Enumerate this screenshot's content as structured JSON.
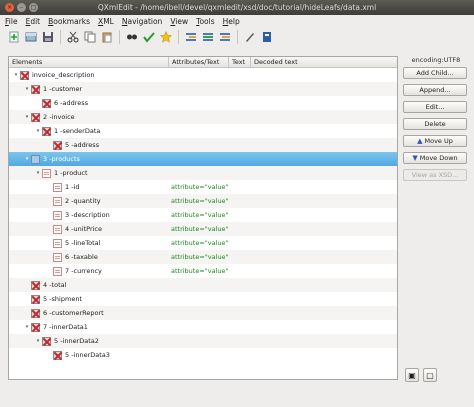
{
  "window": {
    "title": "QXmlEdit - /home/ibell/devel/qxmledit/xsd/doc/tutorial/hideLeafs/data.xml",
    "close_glyph": "×",
    "min_glyph": "–",
    "max_glyph": "□"
  },
  "menu": [
    {
      "label": "File",
      "accel": "F",
      "rest": "ile"
    },
    {
      "label": "Edit",
      "accel": "E",
      "rest": "dit"
    },
    {
      "label": "Bookmarks",
      "accel": "B",
      "rest": "ookmarks"
    },
    {
      "label": "XML",
      "accel": "X",
      "rest": "ML"
    },
    {
      "label": "Navigation",
      "accel": "N",
      "rest": "avigation"
    },
    {
      "label": "View",
      "accel": "V",
      "rest": "iew"
    },
    {
      "label": "Tools",
      "accel": "T",
      "rest": "ools"
    },
    {
      "label": "Help",
      "accel": "H",
      "rest": "elp"
    }
  ],
  "toolbar_icons": [
    "new-icon",
    "open-icon",
    "save-icon",
    "cut-icon",
    "copy-icon",
    "paste-icon",
    "find-icon",
    "validate-icon",
    "bookmark-star-icon",
    "indent-icon",
    "add-icon",
    "remove-icon",
    "pen-icon",
    "help-icon"
  ],
  "columns": [
    "Elements",
    "Attributes/Text",
    "Text",
    "Decoded text"
  ],
  "rows": [
    {
      "label": "invoice_description",
      "level": 0,
      "expander": "▾",
      "icon": "el",
      "attr": ""
    },
    {
      "label": "1 -customer",
      "level": 1,
      "expander": "▾",
      "icon": "el",
      "attr": ""
    },
    {
      "label": "6 -address",
      "level": 2,
      "expander": "",
      "icon": "el",
      "attr": ""
    },
    {
      "label": "2 -invoice",
      "level": 1,
      "expander": "▾",
      "icon": "el",
      "attr": ""
    },
    {
      "label": "1 -senderData",
      "level": 2,
      "expander": "▾",
      "icon": "el",
      "attr": ""
    },
    {
      "label": "5 -address",
      "level": 3,
      "expander": "",
      "icon": "el",
      "attr": ""
    },
    {
      "label": "3 -products",
      "level": 1,
      "expander": "▾",
      "icon": "blue",
      "attr": "",
      "selected": true
    },
    {
      "label": "1 -product",
      "level": 2,
      "expander": "▾",
      "icon": "doc",
      "attr": ""
    },
    {
      "label": "1 -id",
      "level": 3,
      "expander": "",
      "icon": "doc",
      "attr": "attribute=\"value\""
    },
    {
      "label": "2 -quantity",
      "level": 3,
      "expander": "",
      "icon": "doc",
      "attr": "attribute=\"value\""
    },
    {
      "label": "3 -description",
      "level": 3,
      "expander": "",
      "icon": "doc",
      "attr": "attribute=\"value\""
    },
    {
      "label": "4 -unitPrice",
      "level": 3,
      "expander": "",
      "icon": "doc",
      "attr": "attribute=\"value\""
    },
    {
      "label": "5 -lineTotal",
      "level": 3,
      "expander": "",
      "icon": "doc",
      "attr": "attribute=\"value\""
    },
    {
      "label": "6 -taxable",
      "level": 3,
      "expander": "",
      "icon": "doc",
      "attr": "attribute=\"value\""
    },
    {
      "label": "7 -currency",
      "level": 3,
      "expander": "",
      "icon": "doc",
      "attr": "attribute=\"value\""
    },
    {
      "label": "4 -total",
      "level": 1,
      "expander": "",
      "icon": "el",
      "attr": ""
    },
    {
      "label": "5 -shipment",
      "level": 1,
      "expander": "",
      "icon": "el",
      "attr": ""
    },
    {
      "label": "6 -customerReport",
      "level": 1,
      "expander": "",
      "icon": "el",
      "attr": ""
    },
    {
      "label": "7 -innerData1",
      "level": 1,
      "expander": "▾",
      "icon": "el",
      "attr": ""
    },
    {
      "label": "5 -innerData2",
      "level": 2,
      "expander": "▾",
      "icon": "el",
      "attr": ""
    },
    {
      "label": "5 -innerData3",
      "level": 3,
      "expander": "",
      "icon": "el",
      "attr": ""
    }
  ],
  "side": {
    "encoding": "encoding:UTF8",
    "add_child": "Add Child...",
    "append": "Append...",
    "edit": "Edit...",
    "delete": "Delete",
    "move_up": "Move Up",
    "move_down": "Move Down",
    "view_xsd": "View as XSD..."
  },
  "colors": {
    "selection": "#51a8df",
    "attribute_text": "#1e8a1e",
    "title_bar": "#3e3d39",
    "close": "#e2623a"
  }
}
